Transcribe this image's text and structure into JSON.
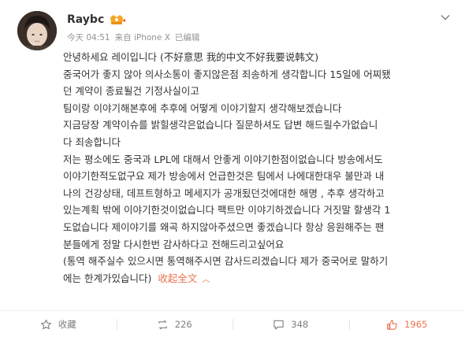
{
  "post": {
    "username": "Raybc",
    "meta": {
      "time": "今天 04:51",
      "source": "来自 iPhone X",
      "edited": "已编辑"
    },
    "lines": [
      "안녕하세요 레이입니다 (不好意思 我的中文不好我要说韩文)",
      "중국어가 좋지 않아 의사소통이 좋지않은점 죄송하게 생각합니다 15일에 어찌됐",
      "던 계약이 종료될건 기정사실이고",
      "팀이랑 이야기해본후에 추후에 어떻게 이야기할지 생각해보겠습니다",
      "지금당장 계약이슈를 밝힐생각은없습니다 질문하셔도 답변 해드릴수가없습니",
      "다  죄송합니다",
      "저는 평소에도 중국과 LPL에 대해서 안좋게 이야기한점이없습니다 방송에서도",
      "이야기한적도없구요 제가 방송에서 언급한것은 팀에서 나에대한대우 불만과 내",
      "나의 건강상태, 데프트형하고 메세지가 공개됬던것에대한 해명 , 추후 생각하고",
      "있는계획 밖에 이야기한것이없습니다 팩트만 이야기하겠습니다 거짓말 할생각 1",
      "도없습니다 제이야기를 왜곡 하지않아주셨으면 좋겠습니다 항상 응원해주는 팬",
      "분들에게 정말 다시한번 감사하다고 전해드리고싶어요",
      "(통역 해주실수 있으시면 통역해주시면 감사드리겠습니다 제가 중국어로 말하기"
    ],
    "last_line": "에는 한계가있습니다)",
    "collapse_label": "收起全文",
    "collapse_arrow": "︿"
  },
  "actions": {
    "favorite_label": "收藏",
    "repost_count": "226",
    "comment_count": "348",
    "like_count": "1965"
  },
  "colors": {
    "accent": "#eb7350",
    "meta": "#939393",
    "text": "#333333",
    "action": "#808080"
  },
  "icons": [
    "chevron-down-icon",
    "vip-badge-icon",
    "star-icon",
    "repost-icon",
    "comment-icon",
    "like-icon"
  ]
}
